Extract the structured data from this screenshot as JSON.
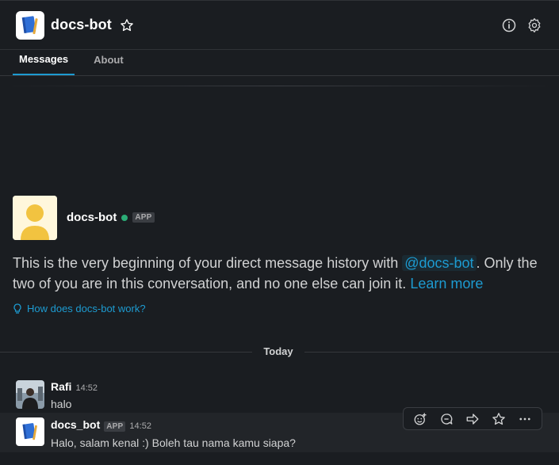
{
  "header": {
    "title": "docs-bot",
    "logo_icon": "notebook-icon",
    "actions": [
      "star-icon",
      "info-icon",
      "gear-icon"
    ]
  },
  "tabs": [
    {
      "label": "Messages",
      "active": true
    },
    {
      "label": "About",
      "active": false
    }
  ],
  "intro": {
    "name": "docs-bot",
    "badge": "APP",
    "presence": "active",
    "text_before": "This is the very beginning of your direct message history with ",
    "mention": "@docs-bot",
    "text_after": ". Only the two of you are in this conversation, and no one else can join it. ",
    "learn_more": "Learn more",
    "how_link": "How does docs-bot work?"
  },
  "divider": {
    "label": "Today"
  },
  "messages": [
    {
      "sender": "Rafi",
      "time": "14:52",
      "text": "halo",
      "badge": ""
    },
    {
      "sender": "docs_bot",
      "time": "14:52",
      "text": "Halo, salam kenal :) Boleh tau nama kamu siapa?",
      "badge": "APP"
    }
  ],
  "toolbar": [
    "add-reaction-icon",
    "reply-thread-icon",
    "share-icon",
    "save-icon",
    "more-icon"
  ],
  "colors": {
    "background": "#1a1d21",
    "accent": "#1d9bd1",
    "presence": "#2bac76"
  }
}
